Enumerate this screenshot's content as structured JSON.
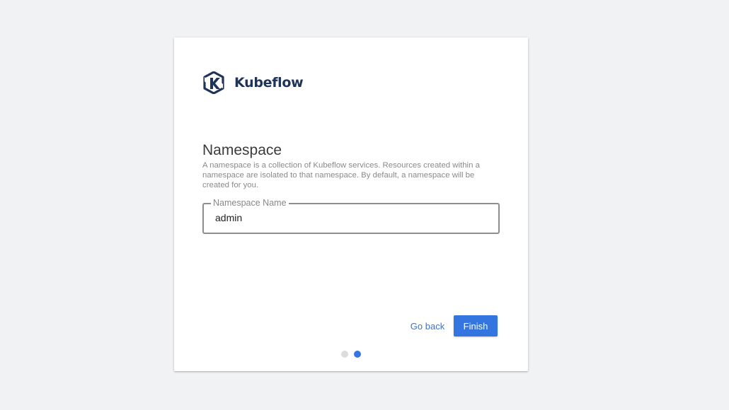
{
  "brand": {
    "name": "Kubeflow",
    "logo_icon": "kubeflow-logo-icon",
    "color": "#20345a"
  },
  "step": {
    "title": "Namespace",
    "description": "A namespace is a collection of Kubeflow services. Resources created within a namespace are isolated to that namespace. By default, a namespace will be created for you."
  },
  "namespace_field": {
    "label": "Namespace Name",
    "value": "admin"
  },
  "actions": {
    "back_label": "Go back",
    "finish_label": "Finish"
  },
  "progress": {
    "total_steps": 2,
    "current_step": 2
  },
  "colors": {
    "accent": "#3575e0",
    "background": "#f1f2f4",
    "card": "#ffffff"
  }
}
